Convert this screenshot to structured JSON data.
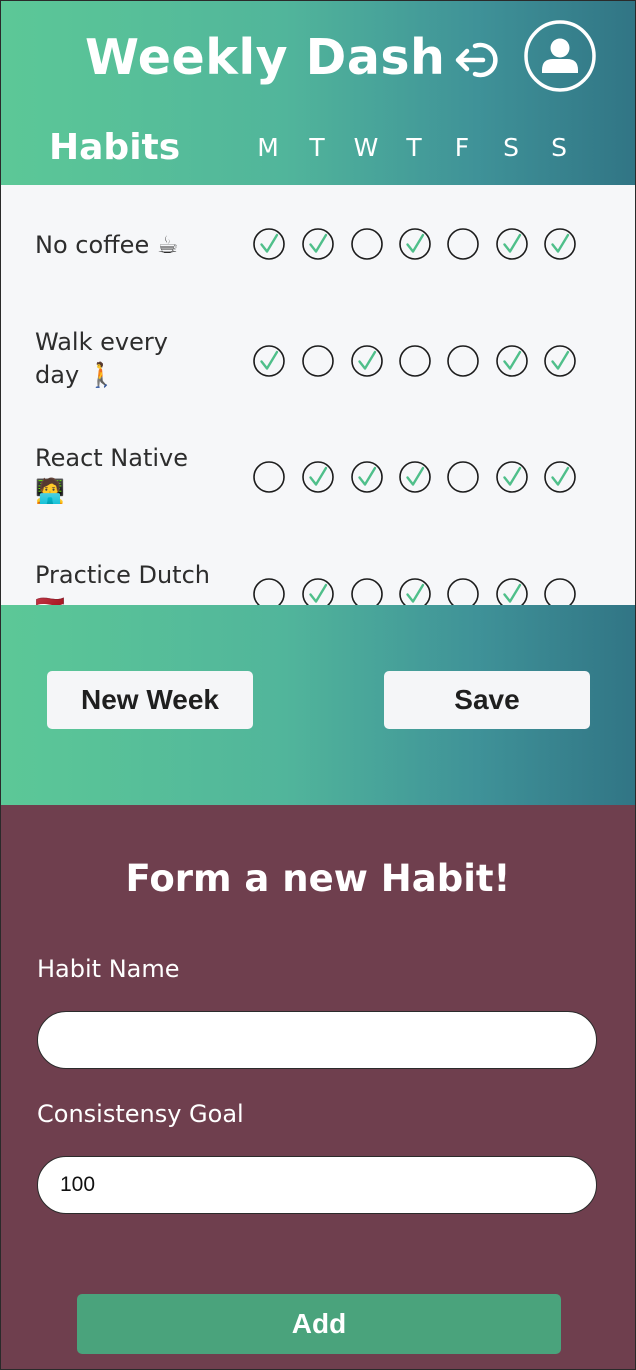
{
  "header": {
    "title": "Weekly Dash",
    "logout_icon": "logout-arrow-icon",
    "account_icon": "user-circle-icon",
    "habits_heading": "Habits",
    "days": [
      "M",
      "T",
      "W",
      "T",
      "F",
      "S",
      "S"
    ]
  },
  "habits": [
    {
      "name": "No coffee ☕",
      "checks": [
        true,
        true,
        false,
        true,
        false,
        true,
        true
      ]
    },
    {
      "name": "Walk every day 🚶",
      "checks": [
        true,
        false,
        true,
        false,
        false,
        true,
        true
      ]
    },
    {
      "name": "React Native 🧑‍💻",
      "checks": [
        false,
        true,
        true,
        true,
        false,
        true,
        true
      ]
    },
    {
      "name": "Practice Dutch 🇳🇱",
      "checks": [
        false,
        true,
        false,
        true,
        false,
        true,
        false
      ]
    }
  ],
  "actions": {
    "new_week_label": "New Week",
    "save_label": "Save"
  },
  "form": {
    "title": "Form a new Habit!",
    "habit_name_label": "Habit Name",
    "habit_name_value": "",
    "goal_label": "Consistensy Goal",
    "goal_value": "100",
    "add_label": "Add"
  },
  "colors": {
    "gradient_start": "#5cc897",
    "gradient_end": "#317585",
    "check_green": "#4fbf8a",
    "form_background": "#6f3f4e",
    "add_button": "#4aa37c"
  }
}
